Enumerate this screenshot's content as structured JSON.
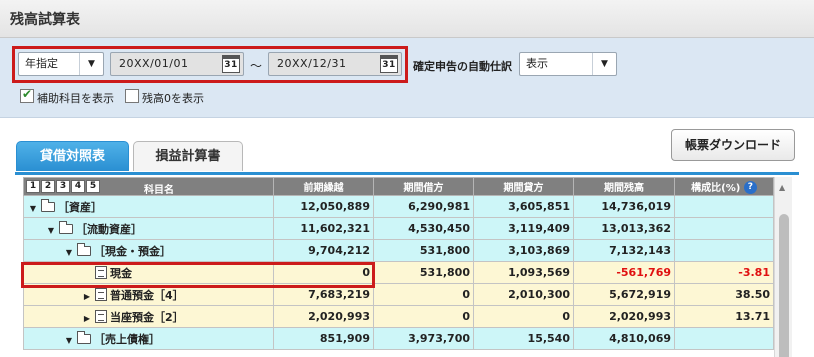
{
  "title": "残高試算表",
  "filter": {
    "period_select": "年指定",
    "date_from": "20XX/01/01",
    "date_to": "20XX/12/31",
    "range_sep": "～",
    "calendar_glyph": "31",
    "auto_journal_label": "確定申告の自動仕訳",
    "auto_journal_value": "表示",
    "chk_sub_label": "補助科目を表示",
    "chk_sub_checked": true,
    "chk_zero_label": "残高0を表示",
    "chk_zero_checked": false
  },
  "tabs": [
    {
      "label": "貸借対照表",
      "active": true
    },
    {
      "label": "損益計算書",
      "active": false
    }
  ],
  "download_label": "帳票ダウンロード",
  "table": {
    "level_buttons": [
      "1",
      "2",
      "3",
      "4",
      "5"
    ],
    "headers": [
      "科目名",
      "前期繰越",
      "期間借方",
      "期間貸方",
      "期間残高",
      "構成比(%)"
    ],
    "help_glyph": "?",
    "rows": [
      {
        "indent": 0,
        "expander": "▼",
        "icon": "folder",
        "name": "［資産］",
        "c1": "12,050,889",
        "c2": "6,290,981",
        "c3": "3,605,851",
        "c4": "14,736,019",
        "c5": "",
        "style": "blue"
      },
      {
        "indent": 1,
        "expander": "▼",
        "icon": "folder",
        "name": "［流動資産］",
        "c1": "11,602,321",
        "c2": "4,530,450",
        "c3": "3,119,409",
        "c4": "13,013,362",
        "c5": "",
        "style": "blue"
      },
      {
        "indent": 2,
        "expander": "▼",
        "icon": "folder",
        "name": "［現金・預金］",
        "c1": "9,704,212",
        "c2": "531,800",
        "c3": "3,103,869",
        "c4": "7,132,143",
        "c5": "",
        "style": "blue"
      },
      {
        "indent": 3,
        "expander": "",
        "icon": "doc",
        "name": "現金",
        "c1": "0",
        "c2": "531,800",
        "c3": "1,093,569",
        "c4": "-561,769",
        "c5": "-3.81",
        "style": "yellow",
        "neg": true
      },
      {
        "indent": 3,
        "expander": "▶",
        "icon": "doc",
        "name": "普通預金［4］",
        "c1": "7,683,219",
        "c2": "0",
        "c3": "2,010,300",
        "c4": "5,672,919",
        "c5": "38.50",
        "style": "yellow"
      },
      {
        "indent": 3,
        "expander": "▶",
        "icon": "doc",
        "name": "当座預金［2］",
        "c1": "2,020,993",
        "c2": "0",
        "c3": "0",
        "c4": "2,020,993",
        "c5": "13.71",
        "style": "yellow"
      },
      {
        "indent": 2,
        "expander": "▼",
        "icon": "folder",
        "name": "［売上債権］",
        "c1": "851,909",
        "c2": "3,973,700",
        "c3": "15,540",
        "c4": "4,810,069",
        "c5": "",
        "style": "blue"
      }
    ]
  },
  "colors": {
    "accent": "#2a8fd2",
    "highlight": "#cc1b1b",
    "negative": "#e01010",
    "row_blue": "#cdf6f8",
    "row_yellow": "#fdf7d4"
  }
}
